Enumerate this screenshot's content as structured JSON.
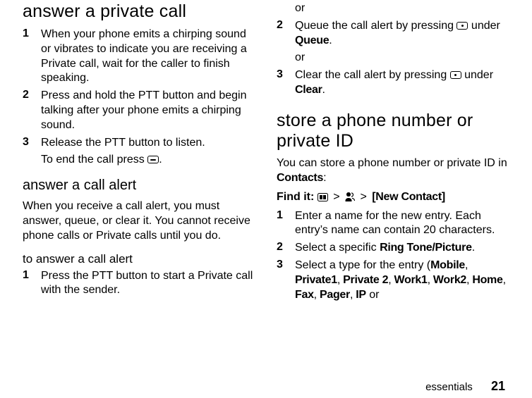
{
  "left": {
    "h1": "answer a private call",
    "steps1": [
      "When your phone emits a chirping sound or vibrates to indicate you are receiving a Private call, wait for the caller to finish speaking.",
      "Press and hold the PTT button and begin talking after your phone emits a chirping sound.",
      "Release the PTT button to listen."
    ],
    "endcall_pre": "To end the call press ",
    "endcall_post": ".",
    "h2": "answer a call alert",
    "p1": "When you receive a call alert, you must answer, queue, or clear it. You cannot receive phone calls or Private calls until you do.",
    "h3": "to answer a call alert",
    "steps2": [
      "Press the PTT button to start a Private call with the sender."
    ]
  },
  "right": {
    "or1": "or",
    "step2_pre": "Queue the call alert by pressing ",
    "step2_mid": " under ",
    "step2_bold": "Queue",
    "step2_post": ".",
    "or2": "or",
    "step3_pre": "Clear the call alert by pressing ",
    "step3_mid": " under ",
    "step3_bold": "Clear",
    "step3_post": ".",
    "h1": "store a phone number or private ID",
    "intro_pre": "You can store a phone number or private ID in ",
    "intro_bold": "Contacts",
    "intro_post": ":",
    "findit_label": "Find it:",
    "findit_bold": "[New Contact]",
    "steps": [
      "Enter a name for the new entry. Each entry’s name can contain 20 characters.",
      {
        "pre": "Select a specific ",
        "bold": "Ring Tone/Picture",
        "post": "."
      },
      {
        "pre": "Select a type for the entry (",
        "list": "Mobile, Private1, Private 2, Work1, Work2, Home, Fax, Pager, IP",
        "post": " or"
      }
    ]
  },
  "footer": {
    "section": "essentials",
    "page": "21"
  }
}
